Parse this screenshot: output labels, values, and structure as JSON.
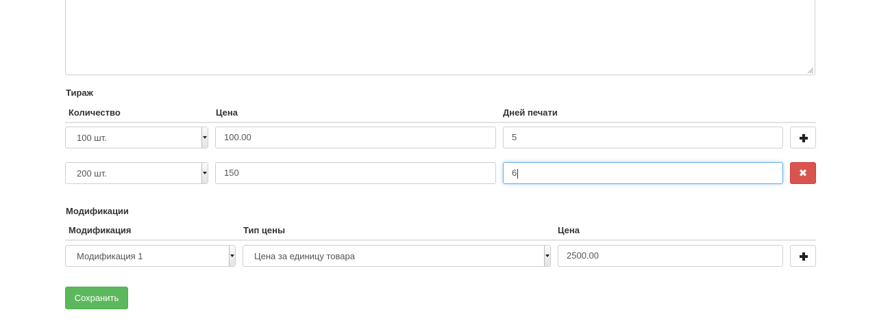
{
  "tirazh": {
    "title": "Тираж",
    "headers": {
      "quantity": "Количество",
      "price": "Цена",
      "days": "Дней печати"
    },
    "rows": [
      {
        "quantity": "100 шт.",
        "price": "100.00",
        "days": "5"
      },
      {
        "quantity": "200 шт.",
        "price": "150",
        "days": "6"
      }
    ]
  },
  "modifications": {
    "title": "Модификации",
    "headers": {
      "modification": "Модификация",
      "price_type": "Тип цены",
      "price": "Цена"
    },
    "rows": [
      {
        "modification": "Модификация 1",
        "price_type": "Цена за единицу товара",
        "price": "2500.00"
      }
    ]
  },
  "buttons": {
    "save": "Сохранить",
    "add_icon": "plus-icon",
    "remove_icon": "close-icon"
  },
  "colors": {
    "danger": "#d9534f",
    "success": "#5cb85c",
    "focus": "#66afe9"
  }
}
